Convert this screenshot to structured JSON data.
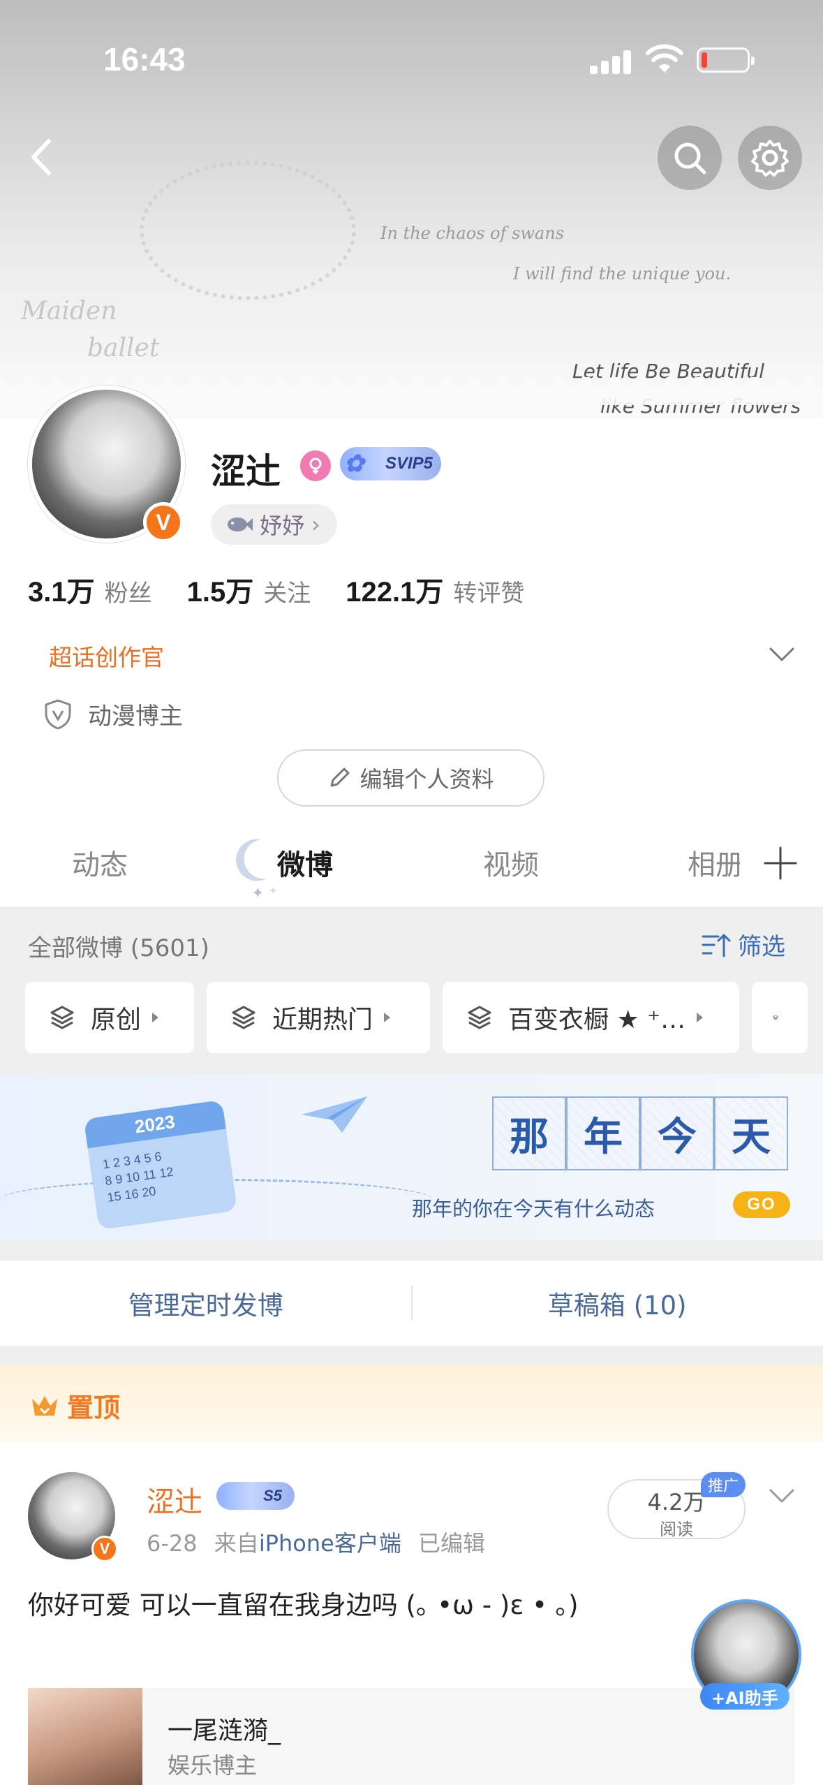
{
  "status_bar": {
    "time": "16:43"
  },
  "banner": {
    "text_1": "In the chaos of swans",
    "text_2": "I will find the unique you.",
    "text_3": "Maiden",
    "text_4": "ballet",
    "text_5": "Let life Be Beautiful",
    "text_6": "like Summer flowers",
    "text_7": "life"
  },
  "profile": {
    "name": "涩辻",
    "vip_badge": "SVIP5",
    "tag": "妤妤",
    "stats": [
      {
        "num": "3.1万",
        "label": "粉丝"
      },
      {
        "num": "1.5万",
        "label": "关注"
      },
      {
        "num": "122.1万",
        "label": "转评赞"
      }
    ],
    "creator_title": "超话创作官",
    "certification": "动漫博主",
    "edit_button": "编辑个人资料"
  },
  "tabs": [
    {
      "label": "动态"
    },
    {
      "label": "微博",
      "active": true
    },
    {
      "label": "视频"
    },
    {
      "label": "相册"
    }
  ],
  "feed_header": {
    "all_label": "全部微博 (5601)",
    "filter_label": "筛选"
  },
  "categories": [
    {
      "label": "原创"
    },
    {
      "label": "近期热门"
    },
    {
      "label": "百变衣橱 ★ ⁺…"
    }
  ],
  "memory_banner": {
    "calendar_year": "2023",
    "calendar_rows": [
      "1 2 3 4 5 6",
      "8 9 10 11 12",
      "15 16    20"
    ],
    "chars": [
      "那",
      "年",
      "今",
      "天"
    ],
    "subtitle": "那年的你在今天有什么动态",
    "go": "GO"
  },
  "actions": {
    "scheduled": "管理定时发博",
    "drafts": "草稿箱 (10)"
  },
  "pinned": {
    "label": "置顶",
    "author": "涩辻",
    "vip_badge": "S5",
    "date": "6-28",
    "source_prefix": "来自",
    "source": "iPhone客户端",
    "edited": "已编辑",
    "reads": "4.2万",
    "reads_label": "阅读",
    "promo_badge": "推广",
    "text": "你好可爱 可以一直留在我身边吗 (｡ •ω - )ε • ｡)"
  },
  "ai_helper": {
    "label": "+AI助手"
  },
  "mention_card": {
    "title": "一尾涟漪_",
    "subtitle": "娱乐博主"
  },
  "colors": {
    "accent_orange": "#ee6d1e",
    "link_blue": "#3b6db7",
    "vip_blue": "#8fb0ff"
  }
}
